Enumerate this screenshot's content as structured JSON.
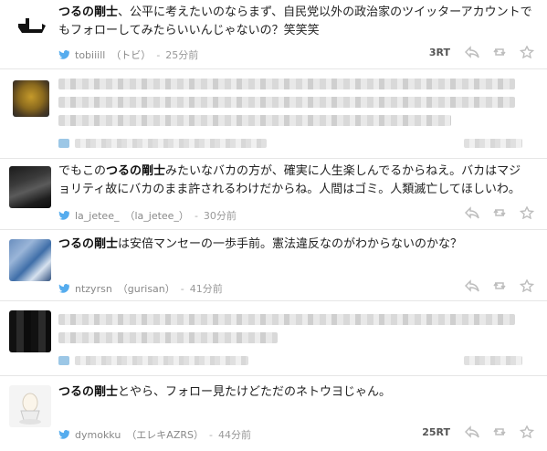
{
  "tweets": [
    {
      "user": "つるの剛士",
      "text_after": "、公平に考えたいのならまず、自民党以外の政治家のツイッターアカウントでもフォローしてみたらいいんじゃないの？笑笑笑",
      "handle": "tobiiill",
      "display_name": "（トビ）",
      "time": "25分前",
      "rt": "3RT"
    },
    {
      "blurred": true
    },
    {
      "text_before": "でもこの",
      "user": "つるの剛士",
      "text_after": "みたいなバカの方が、確実に人生楽しんでるからねえ。バカはマジョリティ故にバカのまま許されるわけだからね。人間はゴミ。人類滅亡してほしいわ。",
      "handle": "la_jetee_",
      "display_name": "（la_jetee_）",
      "time": "30分前"
    },
    {
      "user": "つるの剛士",
      "text_after": "は安倍マンセーの一歩手前。憲法違反なのがわからないのかな？",
      "handle": "ntzyrsn",
      "display_name": "（gurisan）",
      "time": "41分前"
    },
    {
      "blurred": true
    },
    {
      "user": "つるの剛士",
      "text_after": "とやら、フォロー見たけどただのネトウヨじゃん。",
      "handle": "dymokku",
      "display_name": "（エレキAZRS）",
      "time": "44分前",
      "rt": "25RT"
    }
  ],
  "colors": {
    "link_blue": "#55acee",
    "icon_gray": "#bdbdbd"
  }
}
